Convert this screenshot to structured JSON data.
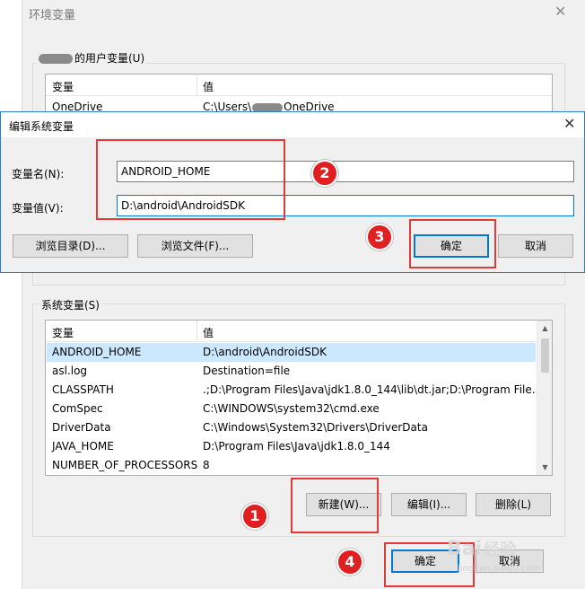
{
  "env_window": {
    "title": "环境变量",
    "close_glyph": "✕",
    "user_group": {
      "legend_suffix": "的用户变量(U)",
      "headers": [
        "变量",
        "值"
      ],
      "rows": [
        {
          "name": "OneDrive",
          "value_prefix": "C:\\Users\\",
          "value_suffix": "OneDrive"
        }
      ]
    },
    "system_group": {
      "legend": "系统变量(S)",
      "headers": [
        "变量",
        "值"
      ],
      "rows": [
        {
          "name": "ANDROID_HOME",
          "value": "D:\\android\\AndroidSDK"
        },
        {
          "name": "asl.log",
          "value": "Destination=file"
        },
        {
          "name": "CLASSPATH",
          "value": ".;D:\\Program Files\\Java\\jdk1.8.0_144\\lib\\dt.jar;D:\\Program File..."
        },
        {
          "name": "ComSpec",
          "value": "C:\\WINDOWS\\system32\\cmd.exe"
        },
        {
          "name": "DriverData",
          "value": "C:\\Windows\\System32\\Drivers\\DriverData"
        },
        {
          "name": "JAVA_HOME",
          "value": "D:\\Program Files\\Java\\jdk1.8.0_144"
        },
        {
          "name": "NUMBER_OF_PROCESSORS",
          "value": "8"
        }
      ],
      "selected_index": 0,
      "buttons": {
        "new": "新建(W)...",
        "edit": "编辑(I)...",
        "delete": "删除(L)"
      }
    },
    "buttons": {
      "ok": "确定",
      "cancel": "取消"
    }
  },
  "edit_dialog": {
    "title": "编辑系统变量",
    "close_glyph": "✕",
    "name_label": "变量名(N):",
    "name_value": "ANDROID_HOME",
    "value_label": "变量值(V):",
    "value_value": "D:\\android\\AndroidSDK",
    "buttons": {
      "browse_dir": "浏览目录(D)...",
      "browse_file": "浏览文件(F)...",
      "ok": "确定",
      "cancel": "取消"
    }
  },
  "annotations": {
    "step_numbers": [
      "1",
      "2",
      "3",
      "4"
    ],
    "highlight_color": "#e23a3a",
    "badge_color": "#e02020"
  },
  "watermark": {
    "text": "Bai",
    "text2": "经验",
    "url": "jingyan.baidu.com"
  },
  "scroll_arrows": {
    "up": "▲",
    "down": "▼"
  }
}
